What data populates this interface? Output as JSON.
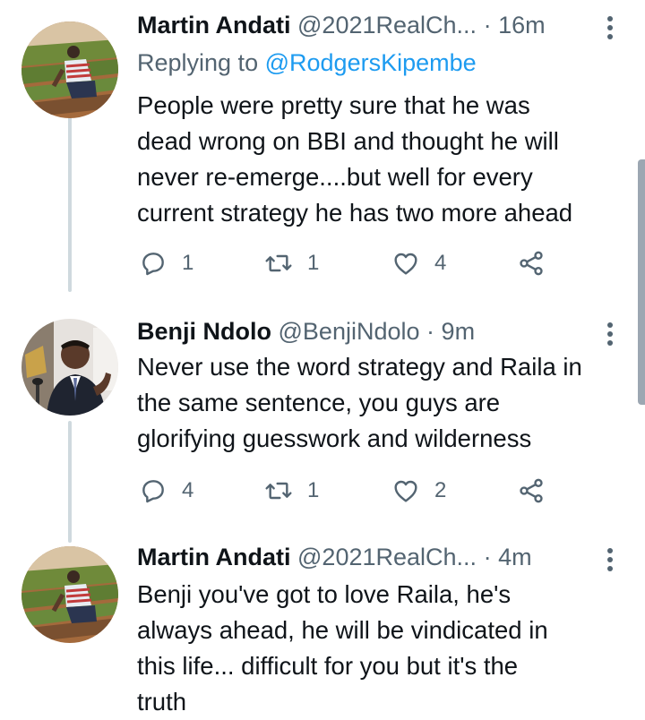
{
  "tweets": [
    {
      "name": "Martin Andati",
      "handle": "@2021RealCh...",
      "separator": "·",
      "time": "16m",
      "replying_prefix": "Replying to",
      "replying_to": "@RodgersKipembe",
      "text": "People were pretty sure that he was\ndead wrong on BBI and thought he will\nnever re-emerge....but well for every\ncurrent strategy he has two more ahead",
      "replies": "1",
      "retweets": "1",
      "likes": "4"
    },
    {
      "name": "Benji Ndolo",
      "handle": "@BenjiNdolo",
      "separator": "·",
      "time": "9m",
      "text": "Never use the word strategy and Raila in\nthe same sentence, you guys are\nglorifying guesswork and wilderness",
      "replies": "4",
      "retweets": "1",
      "likes": "2"
    },
    {
      "name": "Martin Andati",
      "handle": "@2021RealCh...",
      "separator": "·",
      "time": "4m",
      "text": "Benji you've got to love Raila, he's\nalways ahead, he will be vindicated in\nthis life... difficult for you but it's the\ntruth"
    }
  ],
  "colors": {
    "text": "#0f1419",
    "secondary": "#536471",
    "link": "#1d9bf0",
    "thread_line": "#cfd9de"
  },
  "icons": {
    "reply": "reply-icon",
    "retweet": "retweet-icon",
    "like": "heart-icon",
    "share": "share-icon",
    "more": "more-vertical-icon"
  }
}
